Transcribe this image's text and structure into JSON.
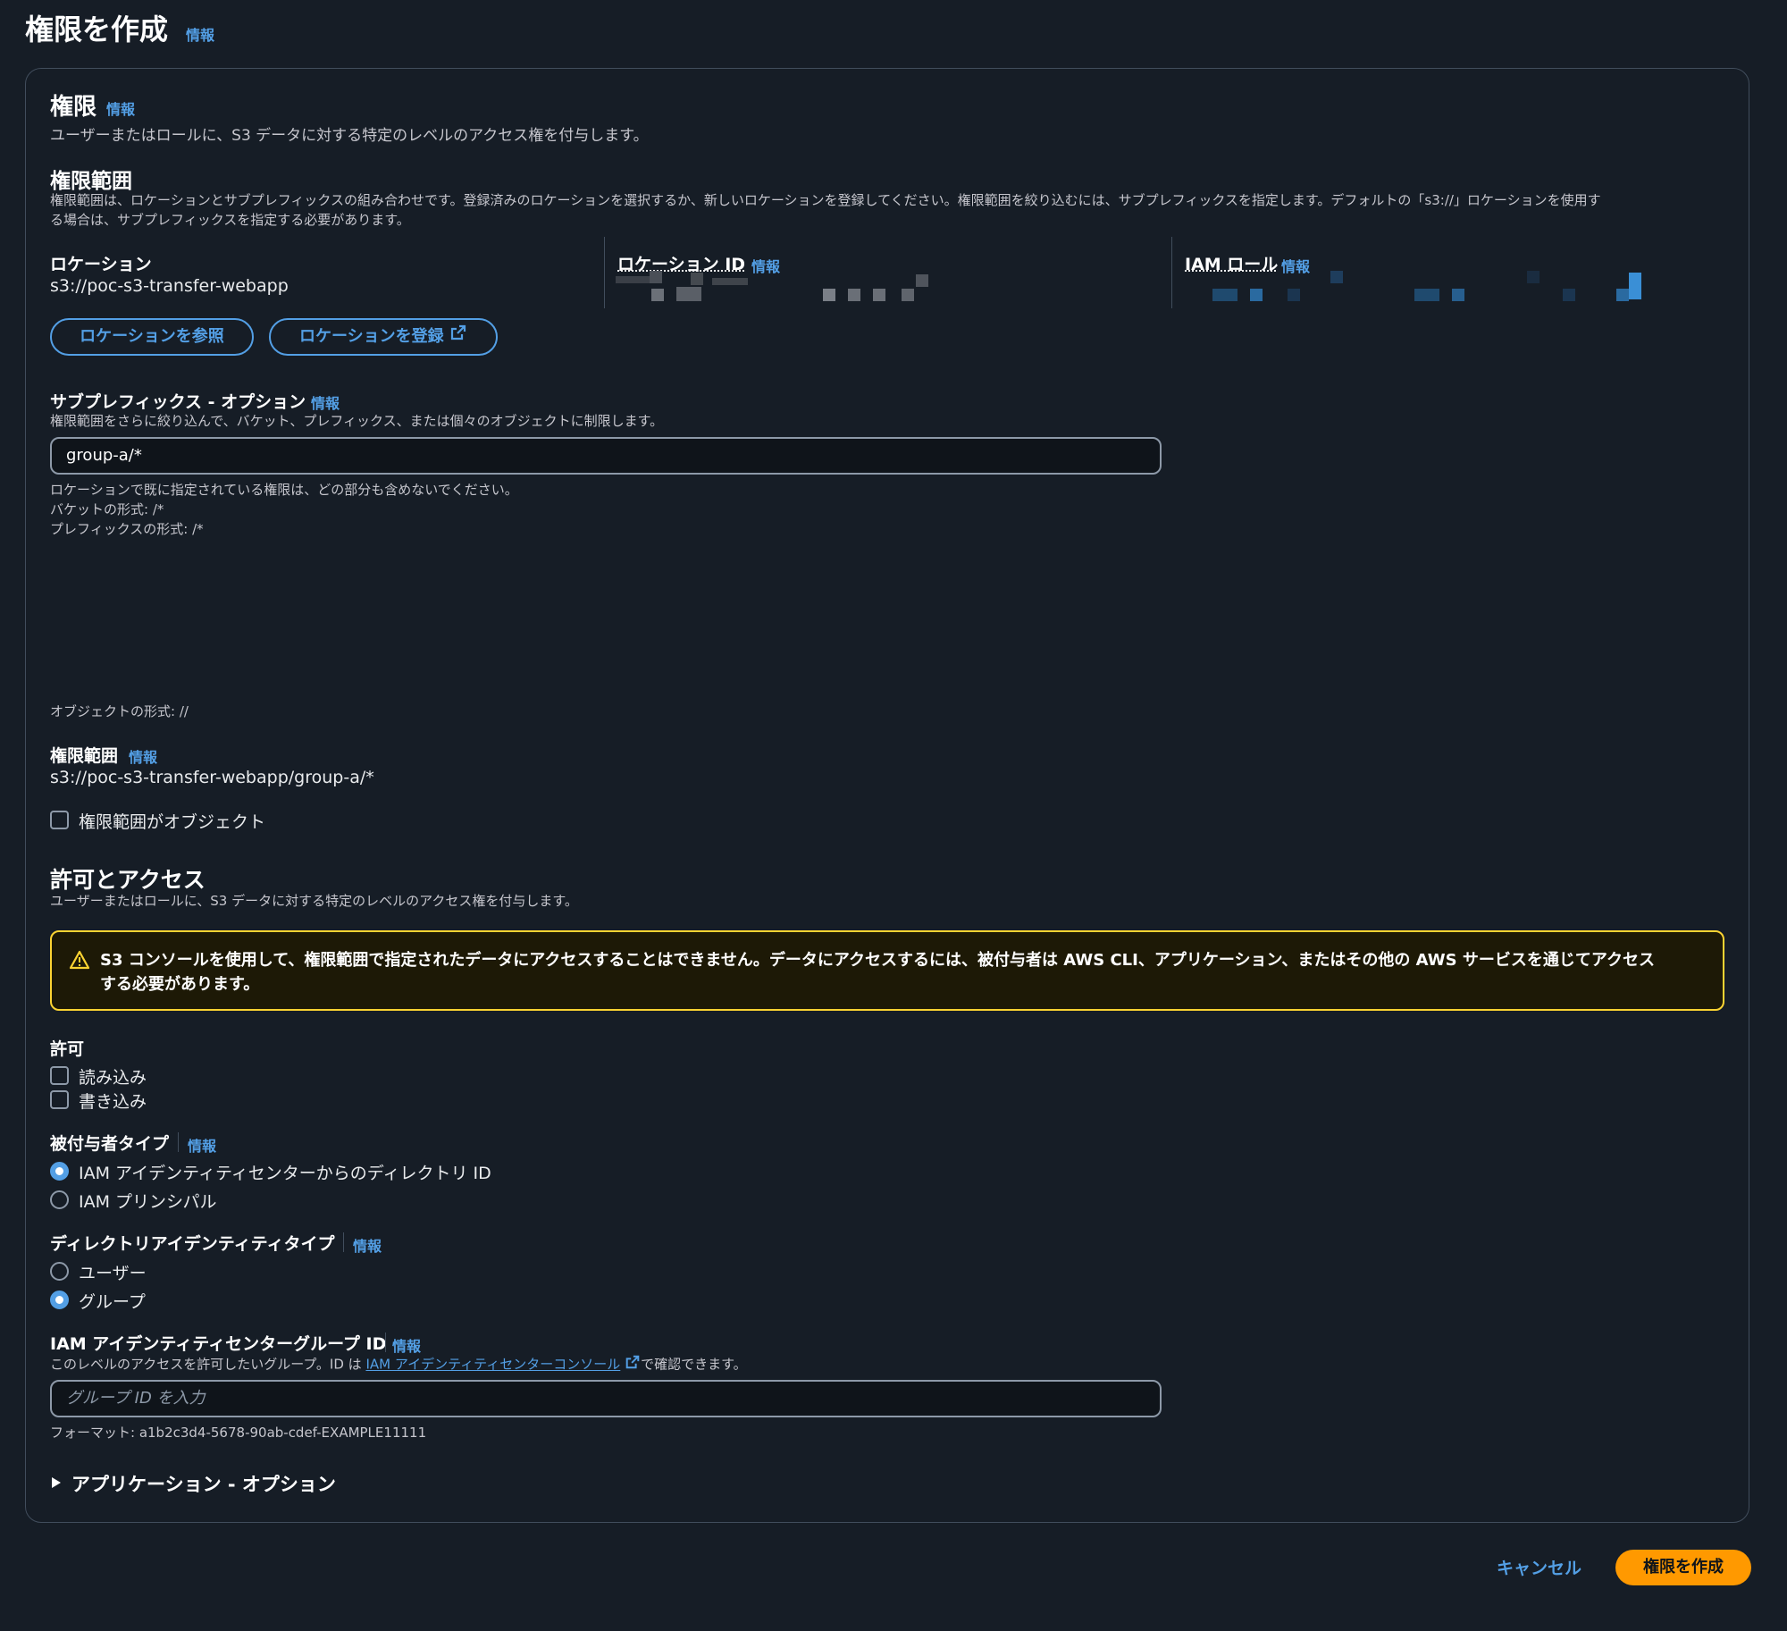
{
  "page": {
    "title": "権限を作成",
    "info": "情報"
  },
  "permission": {
    "heading": "権限",
    "info": "情報",
    "description": "ユーザーまたはロールに、S3 データに対する特定のレベルのアクセス権を付与します。",
    "scope_heading": "権限範囲",
    "scope_desc_1": "権限範囲は、ロケーションとサブプレフィックスの組み合わせです。登録済みのロケーションを選択するか、新しいロケーションを登録してください。権限範囲を絞り込むには、サブプレフィックスを指定します。デフォルトの「s3://」ロケーションを使用す",
    "scope_desc_2": "る場合は、サブプレフィックスを指定する必要があります。",
    "location_label": "ロケーション",
    "location_value": "s3://poc-s3-transfer-webapp",
    "location_id_label": "ロケーション ID",
    "location_id_info": "情報",
    "iam_role_label": "IAM ロール",
    "iam_role_info": "情報",
    "browse_button": "ロケーションを参照",
    "register_button": "ロケーションを登録"
  },
  "subprefix": {
    "label": "サブプレフィックス - オプション",
    "info": "情報",
    "description": "権限範囲をさらに絞り込んで、バケット、プレフィックス、または個々のオブジェクトに制限します。",
    "value": "group-a/*",
    "hint_1": "ロケーションで既に指定されている権限は、どの部分も含めないでください。",
    "hint_2": "バケットの形式: /*",
    "hint_3": "プレフィックスの形式: /*",
    "hint_4": "オブジェクトの形式: //"
  },
  "scope": {
    "label": "権限範囲",
    "info": "情報",
    "value": "s3://poc-s3-transfer-webapp/group-a/*",
    "object_checkbox_label": "権限範囲がオブジェクト"
  },
  "access": {
    "heading": "許可とアクセス",
    "description": "ユーザーまたはロールに、S3 データに対する特定のレベルのアクセス権を付与します。",
    "warning_1": "S3 コンソールを使用して、権限範囲で指定されたデータにアクセスすることはできません。データにアクセスするには、被付与者は AWS CLI、アプリケーション、またはその他の AWS サービスを通じてアクセス",
    "warning_2": "する必要があります。",
    "permission_label": "許可",
    "read_label": "読み込み",
    "write_label": "書き込み",
    "grantee_type_label": "被付与者タイプ",
    "grantee_type_info": "情報",
    "grantee_option_1": "IAM アイデンティティセンターからのディレクトリ ID",
    "grantee_option_2": "IAM プリンシパル",
    "directory_type_label": "ディレクトリアイデンティティタイプ",
    "directory_type_info": "情報",
    "directory_option_1": "ユーザー",
    "directory_option_2": "グループ",
    "group_id_label": "IAM アイデンティティセンターグループ ID",
    "group_id_info": "情報",
    "group_id_desc_pre": "このレベルのアクセスを許可したいグループ。ID は",
    "group_id_desc_link": "IAM アイデンティティセンターコンソール",
    "group_id_desc_post": "で確認できます。",
    "group_id_placeholder": "グループ ID を入力",
    "group_id_format": "フォーマット: a1b2c3d4-5678-90ab-cdef-EXAMPLE11111",
    "application_expander": "アプリケーション - オプション"
  },
  "footer": {
    "cancel": "キャンセル",
    "create": "権限を作成"
  },
  "colors": {
    "background": "#161d26",
    "accent": "#539fe5",
    "warning_border": "#fbd332",
    "primary_button": "#ff9900"
  }
}
